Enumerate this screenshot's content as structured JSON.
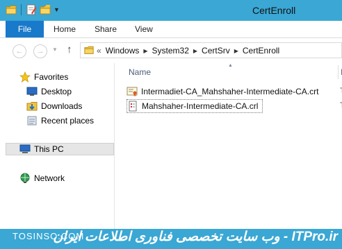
{
  "window": {
    "title": "CertEnroll"
  },
  "quick_access_toolbar": {
    "icons": [
      "folder-icon",
      "properties-icon",
      "new-folder-icon",
      "customize-dropdown-icon"
    ]
  },
  "ribbon": {
    "file_tab": "File",
    "tabs": [
      "Home",
      "Share",
      "View"
    ]
  },
  "address_bar": {
    "overflow": "«",
    "breadcrumbs": [
      "Windows",
      "System32",
      "CertSrv",
      "CertEnroll"
    ]
  },
  "nav_pane": {
    "favorites": {
      "label": "Favorites",
      "items": [
        "Desktop",
        "Downloads",
        "Recent places"
      ]
    },
    "this_pc": "This PC",
    "network": "Network"
  },
  "file_list": {
    "column_name": "Name",
    "column_next": "I",
    "files": [
      {
        "name": "Intermadiet-CA_Mahshaher-Intermediate-CA.crt",
        "type_trunc": "T",
        "icon": "certificate-icon"
      },
      {
        "name": "Mahshaher-Intermediate-CA.crl",
        "type_trunc": "T",
        "icon": "crl-file-icon"
      }
    ]
  },
  "watermark": {
    "left": "TOSINSO.COM",
    "right": "ITPro.ir - وب سایت تخصصی فناوری اطلاعات ایران"
  }
}
